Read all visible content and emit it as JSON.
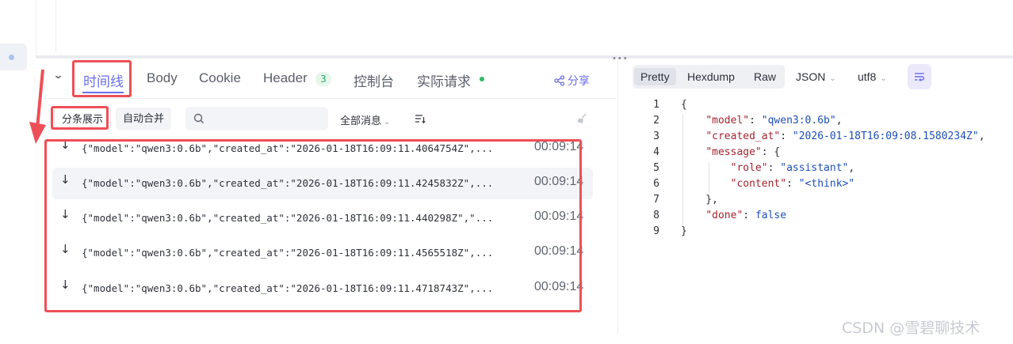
{
  "tabs": [
    {
      "label": "时间线",
      "active": true
    },
    {
      "label": "Body"
    },
    {
      "label": "Cookie"
    },
    {
      "label": "Header",
      "count": "3"
    },
    {
      "label": "控制台"
    },
    {
      "label": "实际请求",
      "status_dot": true
    }
  ],
  "share_label": "分享",
  "filters": {
    "split_view": "分条展示",
    "merge": "自动合并",
    "search_placeholder": "",
    "message_type": "全部消息"
  },
  "messages": [
    {
      "text": "{\"model\":\"qwen3:0.6b\",\"created_at\":\"2026-01-18T16:09:11.4064754Z\",...",
      "time": "00:09:14"
    },
    {
      "text": "{\"model\":\"qwen3:0.6b\",\"created_at\":\"2026-01-18T16:09:11.4245832Z\",...",
      "time": "00:09:14"
    },
    {
      "text": "{\"model\":\"qwen3:0.6b\",\"created_at\":\"2026-01-18T16:09:11.440298Z\",\"...",
      "time": "00:09:14"
    },
    {
      "text": "{\"model\":\"qwen3:0.6b\",\"created_at\":\"2026-01-18T16:09:11.4565518Z\",...",
      "time": "00:09:14"
    },
    {
      "text": "{\"model\":\"qwen3:0.6b\",\"created_at\":\"2026-01-18T16:09:11.4718743Z\",...",
      "time": "00:09:14"
    }
  ],
  "viewer": {
    "modes": [
      "Pretty",
      "Hexdump",
      "Raw"
    ],
    "selected_mode": "Pretty",
    "format": "JSON",
    "encoding": "utf8"
  },
  "code_lines": [
    {
      "n": "1",
      "parts": [
        {
          "t": "{",
          "c": "p"
        }
      ]
    },
    {
      "n": "2",
      "parts": [
        {
          "t": "    ",
          "c": "p"
        },
        {
          "t": "\"model\"",
          "c": "k"
        },
        {
          "t": ": ",
          "c": "p"
        },
        {
          "t": "\"qwen3:0.6b\"",
          "c": "s"
        },
        {
          "t": ",",
          "c": "p"
        }
      ]
    },
    {
      "n": "3",
      "parts": [
        {
          "t": "    ",
          "c": "p"
        },
        {
          "t": "\"created_at\"",
          "c": "k"
        },
        {
          "t": ": ",
          "c": "p"
        },
        {
          "t": "\"2026-01-18T16:09:08.1580234Z\"",
          "c": "s"
        },
        {
          "t": ",",
          "c": "p"
        }
      ]
    },
    {
      "n": "4",
      "parts": [
        {
          "t": "    ",
          "c": "p"
        },
        {
          "t": "\"message\"",
          "c": "k"
        },
        {
          "t": ": {",
          "c": "p"
        }
      ]
    },
    {
      "n": "5",
      "parts": [
        {
          "t": "        ",
          "c": "p"
        },
        {
          "t": "\"role\"",
          "c": "k"
        },
        {
          "t": ": ",
          "c": "p"
        },
        {
          "t": "\"assistant\"",
          "c": "s"
        },
        {
          "t": ",",
          "c": "p"
        }
      ]
    },
    {
      "n": "6",
      "parts": [
        {
          "t": "        ",
          "c": "p"
        },
        {
          "t": "\"content\"",
          "c": "k"
        },
        {
          "t": ": ",
          "c": "p"
        },
        {
          "t": "\"<think>\"",
          "c": "s"
        }
      ]
    },
    {
      "n": "7",
      "parts": [
        {
          "t": "    },",
          "c": "p"
        }
      ]
    },
    {
      "n": "8",
      "parts": [
        {
          "t": "    ",
          "c": "p"
        },
        {
          "t": "\"done\"",
          "c": "k"
        },
        {
          "t": ": ",
          "c": "p"
        },
        {
          "t": "false",
          "c": "b"
        }
      ]
    },
    {
      "n": "9",
      "parts": [
        {
          "t": "}",
          "c": "p"
        }
      ]
    }
  ],
  "watermark": "CSDN @雪碧聊技术",
  "colors": {
    "accent": "#6a6ee6",
    "annotation": "#ee4f57",
    "status_green": "#2fb86a"
  }
}
